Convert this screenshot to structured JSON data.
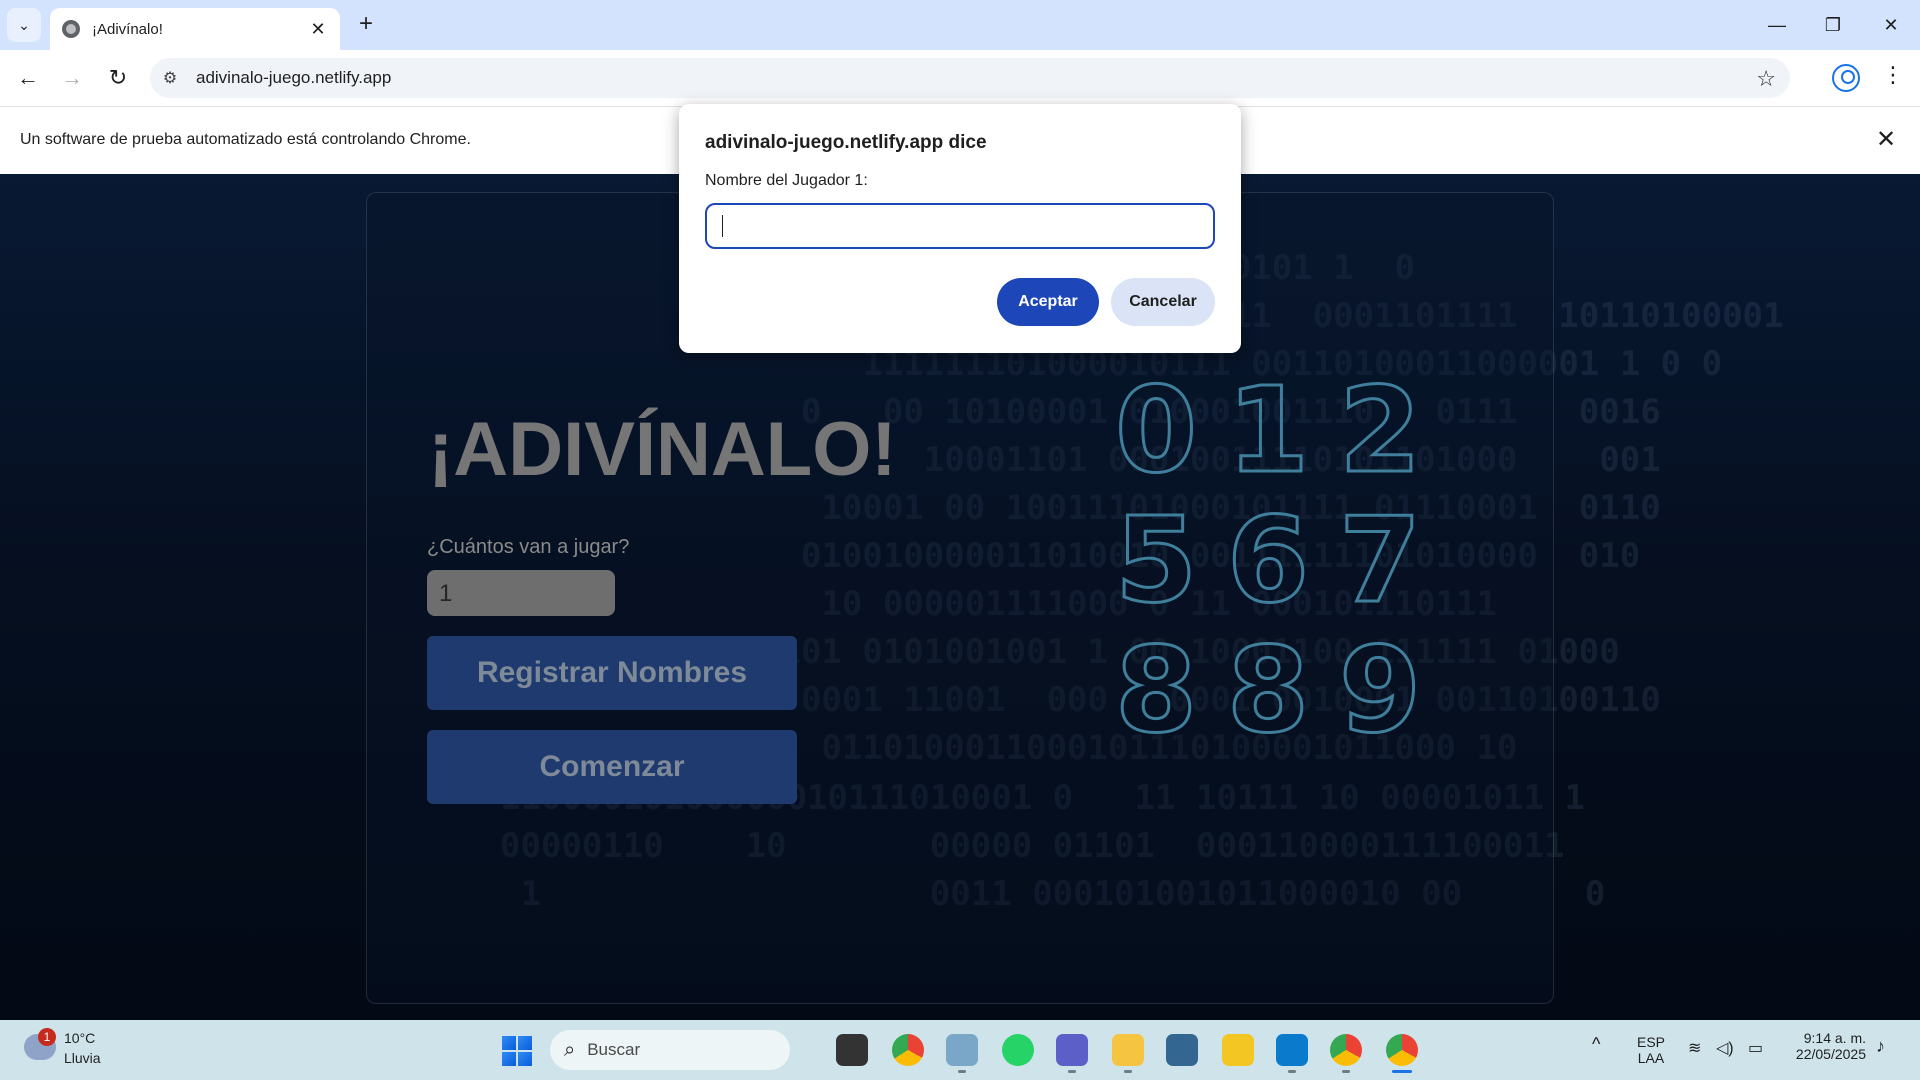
{
  "browser": {
    "tab_title": "¡Adivínalo!",
    "url": "adivinalo-juego.netlify.app",
    "infobar_message": "Un software de prueba automatizado está controlando Chrome."
  },
  "game": {
    "title": "¡ADIVÍNALO!",
    "players_label": "¿Cuántos van a jugar?",
    "players_value": "1",
    "register_button": "Registrar Nombres",
    "start_button": "Comenzar",
    "digits": [
      "0",
      "1",
      "2",
      "5",
      "6",
      "7",
      "8",
      "8",
      "9"
    ]
  },
  "dialog": {
    "title": "adivinalo-juego.netlify.app dice",
    "label": "Nombre del Jugador 1:",
    "input_value": "",
    "ok_button": "Aceptar",
    "cancel_button": "Cancelar"
  },
  "taskbar": {
    "weather_badge": "1",
    "temperature": "10°C",
    "weather_desc": "Lluvia",
    "search_placeholder": "Buscar",
    "lang_line1": "ESP",
    "lang_line2": "LAA",
    "time": "9:14 a. m.",
    "date": "22/05/2025"
  },
  "colors": {
    "dialog_accent": "#1d46b8",
    "game_button": "#1e3a6e"
  }
}
